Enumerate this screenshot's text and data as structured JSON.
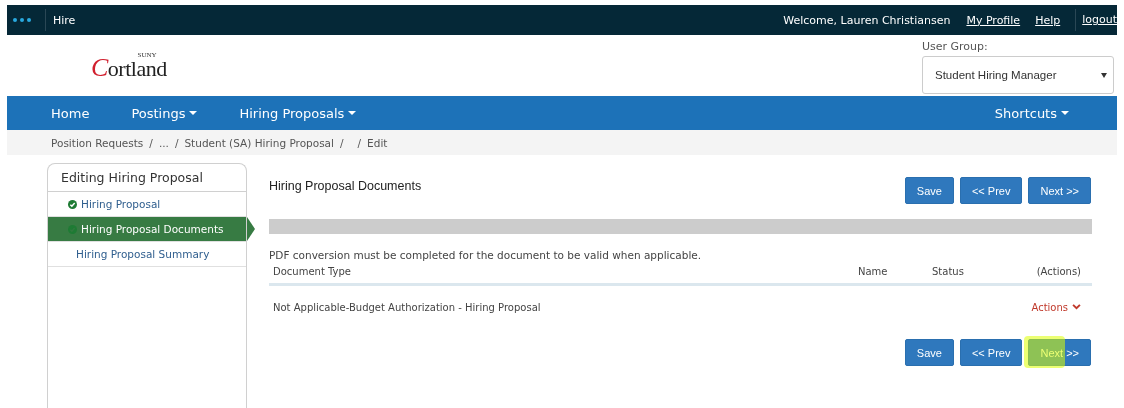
{
  "top_bar": {
    "app_name": "Hire",
    "welcome": "Welcome, Lauren Christiansen",
    "links": [
      "My Profile",
      "Help",
      "logout"
    ]
  },
  "logo": {
    "superscript": "SUNY",
    "name": "Cortland"
  },
  "user_group": {
    "label": "User Group:",
    "value": "Student Hiring Manager"
  },
  "nav": {
    "items": [
      {
        "label": "Home",
        "dropdown": false
      },
      {
        "label": "Postings",
        "dropdown": true
      },
      {
        "label": "Hiring Proposals",
        "dropdown": true
      }
    ],
    "right": {
      "label": "Shortcuts",
      "dropdown": true
    }
  },
  "breadcrumb": [
    {
      "kind": "link",
      "text": "Position Requests"
    },
    {
      "kind": "separator",
      "text": "/"
    },
    {
      "kind": "link",
      "text": "..."
    },
    {
      "kind": "separator",
      "text": "/"
    },
    {
      "kind": "link",
      "text": "Student (SA) Hiring Proposal"
    },
    {
      "kind": "separator",
      "text": "/"
    },
    {
      "kind": "separator",
      "text": "/"
    },
    {
      "kind": "link",
      "text": "Edit"
    }
  ],
  "sidebar": {
    "title": "Editing Hiring Proposal",
    "items": [
      {
        "label": "Hiring Proposal",
        "complete": true,
        "selected": false
      },
      {
        "label": "Hiring Proposal Documents",
        "complete": true,
        "selected": true
      },
      {
        "label": "Hiring Proposal Summary",
        "complete": false,
        "selected": false
      }
    ]
  },
  "main": {
    "title": "Hiring Proposal Documents",
    "top_buttons": [
      {
        "label": "Save",
        "highlighted": false
      },
      {
        "label": "<< Prev",
        "highlighted": false
      },
      {
        "label": "Next >>",
        "highlighted": false
      }
    ],
    "note": "PDF conversion must be completed for the document to be valid when applicable.",
    "table": {
      "columns": [
        "Document Type",
        "Name",
        "Status",
        "(Actions)"
      ],
      "rows": [
        {
          "document_type": "Not Applicable-Budget Authorization - Hiring Proposal",
          "actions": "Actions"
        }
      ]
    },
    "bottom_buttons": [
      {
        "label": "Save",
        "highlighted": false
      },
      {
        "label": "<< Prev",
        "highlighted": false
      },
      {
        "label": "Next >>",
        "highlighted": true
      }
    ]
  }
}
